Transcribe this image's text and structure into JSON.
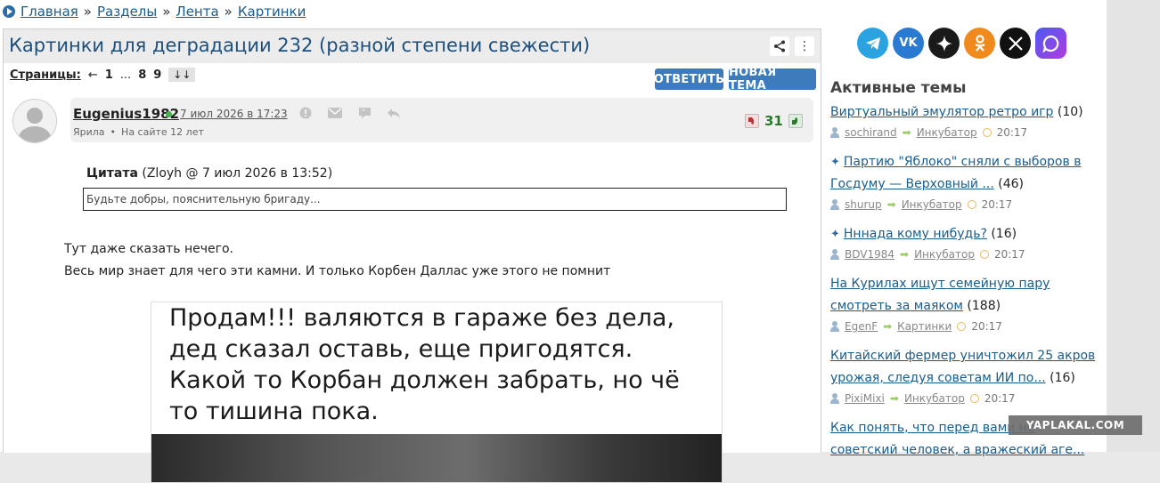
{
  "breadcrumb": {
    "items": [
      "Главная",
      "Разделы",
      "Лента",
      "Картинки"
    ],
    "separator": "»"
  },
  "topic": {
    "title": "Картинки для деградации 232 (разной степени свежести)"
  },
  "pager": {
    "label": "Страницы:",
    "prev": "←",
    "first": "1",
    "ellipsis": "...",
    "p8": "8",
    "p9": "9",
    "jump": "↓↓"
  },
  "actions": {
    "reply": "ОТВЕТИТЬ",
    "new_topic": "НОВАЯ ТЕМА"
  },
  "post": {
    "author": "Eugenius1982",
    "date": "7 июл 2026 в 17:23",
    "status": "Ярила",
    "dot": "•",
    "tenure": "На сайте 12 лет",
    "score": "31",
    "quote_label": "Цитата",
    "quote_src": "(Zloyh @ 7 июл 2026 в 13:52)",
    "quote_text": "Будьте добры, пояснительную бригаду...",
    "text_line1": "Тут даже сказать нечего.",
    "text_line2": "Весь мир знает для чего эти камни. И только Корбен Даллас уже этого не помнит",
    "image_caption": "Продам!!! валяются в гараже без дела, дед сказал оставь, еще пригодятся. Какой то Корбан должен забрать, но чё то тишина пока."
  },
  "sidebar": {
    "social_icons": [
      "telegram-icon",
      "vk-icon",
      "star-icon",
      "odnoklassniki-icon",
      "x-icon",
      "max-icon"
    ],
    "active_title": "Активные темы",
    "topics": [
      {
        "title": "Виртуальный эмулятор ретро игр",
        "count": "(10)",
        "user": "sochirand",
        "section": "Инкубатор",
        "time": "20:17",
        "pinned": false
      },
      {
        "title": "Партию \"Яблоко\" сняли с выборов в Госдуму — Верховный ...",
        "count": "(46)",
        "user": "shurup",
        "section": "Инкубатор",
        "time": "20:17",
        "pinned": true
      },
      {
        "title": "Нннада кому нибудь?",
        "count": "(16)",
        "user": "BDV1984",
        "section": "Инкубатор",
        "time": "20:17",
        "pinned": true
      },
      {
        "title": "На Курилах ищут семейную пару смотреть за маяком",
        "count": "(188)",
        "user": "EgenF",
        "section": "Картинки",
        "time": "20:17",
        "pinned": false
      },
      {
        "title": "Китайский фермер уничтожил 25 акров урожая, следуя советам ИИ по...",
        "count": "(16)",
        "user": "PixiMixi",
        "section": "Инкубатор",
        "time": "20:17",
        "pinned": false
      },
      {
        "title": "Как понять, что перед вами не советский человек, а вражеский аге...",
        "count": "",
        "user": "",
        "section": "",
        "time": "",
        "pinned": false
      }
    ]
  },
  "watermark": "YAPLAKAL.COM",
  "colors": {
    "link": "#1a5c8c",
    "button": "#3d7bbd",
    "score": "#2a7a2a"
  }
}
